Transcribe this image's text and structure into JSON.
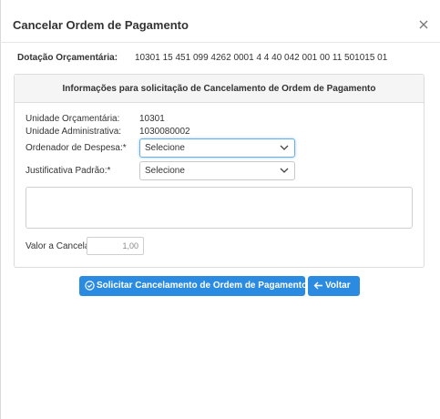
{
  "modal": {
    "title": "Cancelar Ordem de Pagamento",
    "close_icon": "close-icon"
  },
  "dotacao": {
    "label": "Dotação Orçamentária:",
    "value": "10301 15 451 099 4262 0001 4 4 40 042 001 00 11 501015 01"
  },
  "panel": {
    "title": "Informações para solicitação de Cancelamento de Ordem de Pagamento",
    "unidade_orcamentaria": {
      "label": "Unidade Orçamentária:",
      "value": "10301"
    },
    "unidade_administrativa": {
      "label": "Unidade Administrativa:",
      "value": "1030080002"
    },
    "ordenador": {
      "label": "Ordenador de Despesa:",
      "required": "*",
      "selected": "Selecione"
    },
    "justificativa": {
      "label": "Justificativa Padrão:",
      "required": "*",
      "selected": "Selecione"
    },
    "justificativa_text": "",
    "valor": {
      "label": "Valor a Cancelar",
      "value": "1,00"
    }
  },
  "buttons": {
    "solicitar": {
      "label": "Solicitar Cancelamento de Ordem de Pagamento",
      "icon": "check-circle-icon"
    },
    "voltar": {
      "label": "Voltar",
      "icon": "arrow-left-icon"
    }
  },
  "colors": {
    "primary": "#2a8be0",
    "panel_header": "#f5f5f5",
    "focus": "#66afe9"
  }
}
